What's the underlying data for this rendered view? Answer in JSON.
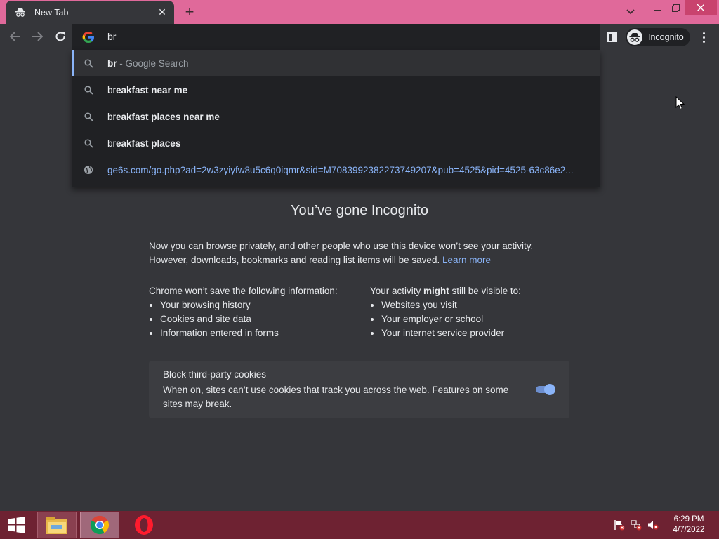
{
  "tab": {
    "title": "New Tab"
  },
  "omnibox": {
    "value": "br"
  },
  "toolbar": {
    "profile_label": "Incognito"
  },
  "suggestions": [
    {
      "icon": "search-icon",
      "prefix": "br",
      "rest": "",
      "suffix": " - Google Search",
      "selected": true
    },
    {
      "icon": "search-icon",
      "prefix": "br",
      "rest": "eakfast near me"
    },
    {
      "icon": "search-icon",
      "prefix": "br",
      "rest": "eakfast places near me"
    },
    {
      "icon": "search-icon",
      "prefix": "br",
      "rest": "eakfast places"
    },
    {
      "icon": "globe-icon",
      "url": "ge6s.com/go.php?ad=2w3zyiyfw8u5c6q0iqmr&sid=M7083992382273749207&pub=4525&pid=4525-63c86e2..."
    }
  ],
  "content": {
    "heading": "You’ve gone Incognito",
    "intro": "Now you can browse privately, and other people who use this device won’t see your activity. However, downloads, bookmarks and reading list items will be saved.",
    "learn_more": "Learn more",
    "left_heading": "Chrome won’t save the following information:",
    "left_items": [
      "Your browsing history",
      "Cookies and site data",
      "Information entered in forms"
    ],
    "right_heading_pre": "Your activity ",
    "right_heading_bold": "might",
    "right_heading_post": " still be visible to:",
    "right_items": [
      "Websites you visit",
      "Your employer or school",
      "Your internet service provider"
    ],
    "cookies_title": "Block third-party cookies",
    "cookies_desc": "When on, sites can’t use cookies that track you across the web. Features on some sites may break.",
    "cookies_toggle_on": true
  },
  "taskbar": {
    "apps": [
      "file-explorer",
      "chrome",
      "opera"
    ],
    "time": "6:29 PM",
    "date": "4/7/2022"
  },
  "colors": {
    "tabstrip": "#e0699a",
    "toolbar": "#35363a",
    "omnibox": "#202124",
    "accent": "#8ab4f8",
    "taskbar": "#6e2232"
  }
}
